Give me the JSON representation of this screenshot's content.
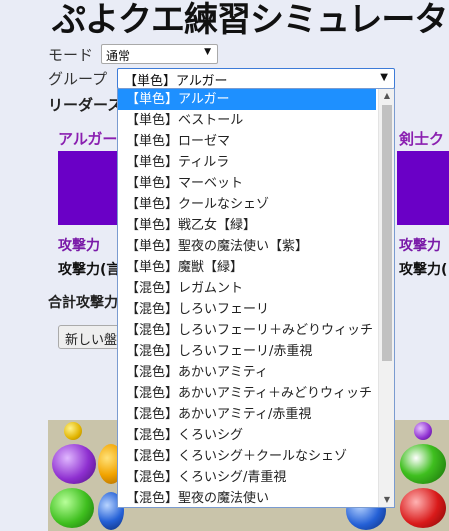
{
  "title": "ぷよクエ練習シミュレータ",
  "mode": {
    "label": "モード",
    "value": "通常"
  },
  "group": {
    "label": "グループ",
    "value": "【単色】アルガー",
    "options": [
      "【単色】アルガー",
      "【単色】ベストール",
      "【単色】ローゼマ",
      "【単色】ティルラ",
      "【単色】マーベット",
      "【単色】クールなシェゾ",
      "【単色】戦乙女【緑】",
      "【単色】聖夜の魔法使い【紫】",
      "【単色】魔獣【緑】",
      "【混色】レガムント",
      "【混色】しろいフェーリ",
      "【混色】しろいフェーリ＋みどりウィッチ",
      "【混色】しろいフェーリ/赤重視",
      "【混色】あかいアミティ",
      "【混色】あかいアミティ＋みどりウィッチ",
      "【混色】あかいアミティ/赤重視",
      "【混色】くろいシグ",
      "【混色】くろいシグ＋クールなシェゾ",
      "【混色】くろいシグ/青重視",
      "【混色】聖夜の魔法使い"
    ]
  },
  "leader_label": "リーダース",
  "cards": {
    "left_title": "アルガー",
    "right_title": "剣士ク",
    "left_attack": "攻撃力",
    "right_attack": "攻撃力",
    "left_attack2": "攻撃力(言",
    "right_attack2": "攻撃力("
  },
  "total_label": "合計攻撃力",
  "new_board_button": "新しい盤",
  "colors": {
    "purple": "#6a00c6",
    "selected_option": "#1e90ff",
    "board": "#c9c4aa"
  }
}
